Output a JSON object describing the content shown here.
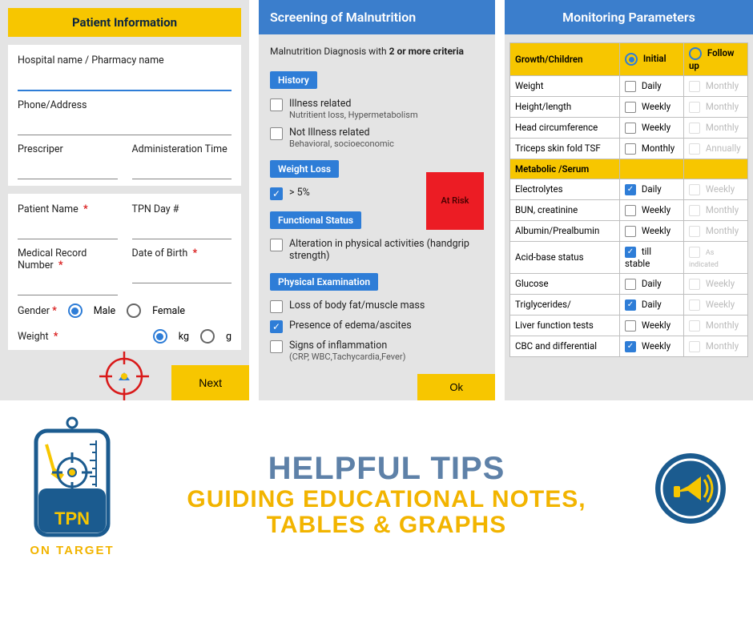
{
  "panel1": {
    "title": "Patient Information",
    "fields": {
      "hospital": "Hospital name / Pharmacy name",
      "phone": "Phone/Address",
      "prescriber": "Prescriper",
      "admin_time": "Administeration Time",
      "patient_name": "Patient Name",
      "tpn_day": "TPN Day #",
      "mrn": "Medical Record Number",
      "dob": "Date of Birth",
      "gender": "Gender",
      "weight": "Weight"
    },
    "gender_options": {
      "male": "Male",
      "female": "Female"
    },
    "weight_units": {
      "kg": "kg",
      "g": "g"
    },
    "next": "Next"
  },
  "panel2": {
    "title": "Screening of Malnutrition",
    "heading_pre": "Malnutrition Diagnosis with ",
    "heading_bold": "2 or more criteria",
    "sections": {
      "history": "History",
      "weight_loss": "Weight Loss",
      "functional": "Functional Status",
      "physical": "Physical Examination"
    },
    "history_items": [
      {
        "main": "Illness related",
        "sub": "Nutritient loss, Hypermetabolism",
        "checked": false
      },
      {
        "main": "Not Illness related",
        "sub": "Behavioral, socioeconomic",
        "checked": false
      }
    ],
    "weight_loss_items": [
      {
        "main": "> 5%",
        "sub": "",
        "checked": true
      }
    ],
    "functional_items": [
      {
        "main": "Alteration in physical activities (handgrip strength)",
        "sub": "",
        "checked": false
      }
    ],
    "physical_items": [
      {
        "main": "Loss of body fat/muscle mass",
        "sub": "",
        "checked": false
      },
      {
        "main": "Presence of edema/ascites",
        "sub": "",
        "checked": true
      },
      {
        "main": "Signs of inflammation",
        "sub": "(CRP, WBC,Tachycardia,Fever)",
        "checked": false
      }
    ],
    "risk_badge": "At Risk",
    "ok": "Ok"
  },
  "panel3": {
    "title": "Monitoring Parameters",
    "cols": {
      "initial": "Initial",
      "follow": "Follow up"
    },
    "groups": {
      "growth": "Growth/Children",
      "metabolic": "Metabolic /Serum"
    },
    "rows_growth": [
      {
        "name": "Weight",
        "c1": "Daily",
        "c1c": false,
        "c2": "Monthly",
        "c2d": true
      },
      {
        "name": "Height/length",
        "c1": "Weekly",
        "c1c": false,
        "c2": "Monthly",
        "c2d": true
      },
      {
        "name": "Head circumference",
        "c1": "Weekly",
        "c1c": false,
        "c2": "Monthly",
        "c2d": true
      },
      {
        "name": "Triceps skin fold TSF",
        "c1": "Monthly",
        "c1c": false,
        "c2": "Annually",
        "c2d": true
      }
    ],
    "rows_metabolic": [
      {
        "name": "Electrolytes",
        "c1": "Daily",
        "c1c": true,
        "c2": "Weekly",
        "c2d": true
      },
      {
        "name": "BUN, creatinine",
        "c1": "Weekly",
        "c1c": false,
        "c2": "Monthly",
        "c2d": true
      },
      {
        "name": "Albumin/Prealbumin",
        "c1": "Weekly",
        "c1c": false,
        "c2": "Monthly",
        "c2d": true
      },
      {
        "name": "Acid-base status",
        "c1": "till stable",
        "c1c": true,
        "c2": "As indicated",
        "c2d": true
      },
      {
        "name": "Glucose",
        "c1": "Daily",
        "c1c": false,
        "c2": "Weekly",
        "c2d": true
      },
      {
        "name": "Triglycerides/",
        "c1": "Daily",
        "c1c": true,
        "c2": "Weekly",
        "c2d": true
      },
      {
        "name": "Liver function tests",
        "c1": "Weekly",
        "c1c": false,
        "c2": "Monthly",
        "c2d": true
      },
      {
        "name": "CBC and differential",
        "c1": "Weekly",
        "c1c": true,
        "c2": "Monthly",
        "c2d": true
      }
    ]
  },
  "footer": {
    "logo_main": "TPN",
    "logo_sub": "ON TARGET",
    "tips": "HELPFUL TIPS",
    "subtitle": "GUIDING EDUCATIONAL NOTES, TABLES & GRAPHS"
  }
}
